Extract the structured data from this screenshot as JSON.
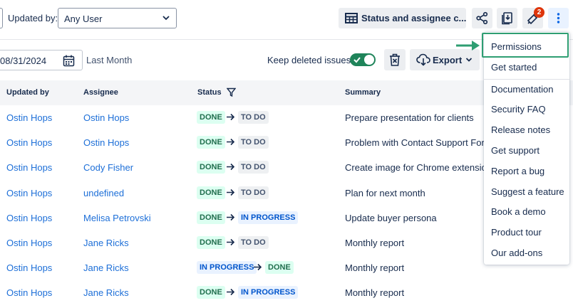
{
  "toolbar": {
    "updated_by_label": "Updated by:",
    "updated_by_value": "Any User",
    "view_label": "Status and assignee c...",
    "notification_count": "2"
  },
  "filters": {
    "date_value": "08/31/2024",
    "range_label": "Last Month",
    "keep_deleted_label": "Keep deleted issues",
    "keep_deleted_on": true,
    "export_label": "Export"
  },
  "table": {
    "headers": [
      "Updated by",
      "Assignee",
      "Status",
      "Summary"
    ],
    "rows": [
      {
        "updated_by": "Ostin Hops",
        "assignee": "Ostin Hops",
        "from": "DONE",
        "to": "TO DO",
        "summary": "Prepare presentation for clients"
      },
      {
        "updated_by": "Ostin Hops",
        "assignee": "Ostin Hops",
        "from": "DONE",
        "to": "TO DO",
        "summary": "Problem with Contact Support Forr"
      },
      {
        "updated_by": "Ostin Hops",
        "assignee": "Cody Fisher",
        "from": "DONE",
        "to": "TO DO",
        "summary": "Create image for Chrome extension"
      },
      {
        "updated_by": "Ostin Hops",
        "assignee": "undefined",
        "from": "DONE",
        "to": "TO DO",
        "summary": "Plan for next month"
      },
      {
        "updated_by": "Ostin Hops",
        "assignee": "Melisa Petrovski",
        "from": "DONE",
        "to": "IN PROGRESS",
        "summary": "Update buyer persona"
      },
      {
        "updated_by": "Ostin Hops",
        "assignee": "Jane Ricks",
        "from": "DONE",
        "to": "TO DO",
        "summary": "Monthly report"
      },
      {
        "updated_by": "Ostin Hops",
        "assignee": "Jane Ricks",
        "from": "IN PROGRESS",
        "to": "DONE",
        "summary": "Monthly report"
      },
      {
        "updated_by": "Ostin Hops",
        "assignee": "Jane Ricks",
        "from": "DONE",
        "to": "IN PROGRESS",
        "summary": "Monthly report"
      }
    ]
  },
  "menu": {
    "items": [
      "Permissions",
      "Get started",
      "Documentation",
      "Security FAQ",
      "Release notes",
      "Get support",
      "Report a bug",
      "Suggest a feature",
      "Book a demo",
      "Product tour",
      "Our add-ons"
    ]
  },
  "colors": {
    "link": "#1d6fd8",
    "toggle_on": "#1f845a",
    "highlight": "#2e9e72",
    "badge": "#de350b"
  }
}
